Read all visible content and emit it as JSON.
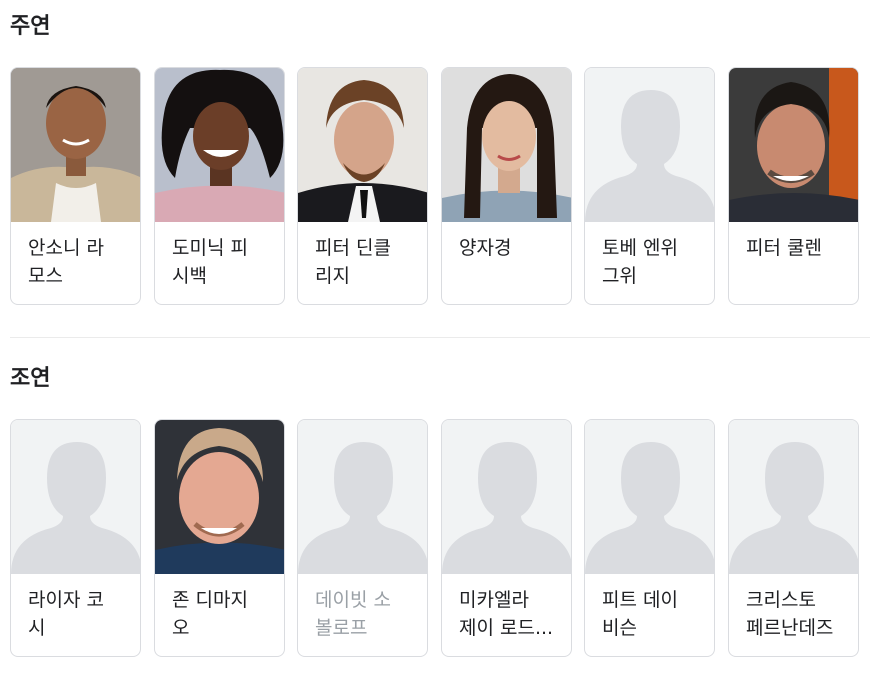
{
  "sections": [
    {
      "title": "주연",
      "cast": [
        {
          "name": "안소니 라\n모스",
          "photo": "person-photo"
        },
        {
          "name": "도미닉 피\n시백",
          "photo": "person-photo"
        },
        {
          "name": "피터 딘클\n리지",
          "photo": "person-photo"
        },
        {
          "name": "양자경",
          "photo": "person-photo"
        },
        {
          "name": "토베 엔위\n그위",
          "photo": "placeholder-silhouette"
        },
        {
          "name": "피터 쿨렌",
          "photo": "person-photo"
        }
      ]
    },
    {
      "title": "조연",
      "cast": [
        {
          "name": "라이자 코\n시",
          "photo": "placeholder-silhouette"
        },
        {
          "name": "존 디마지\n오",
          "photo": "person-photo"
        },
        {
          "name": "데이빗 소\n볼로프",
          "photo": "placeholder-silhouette"
        },
        {
          "name": "미카엘라\n제이 로드...",
          "photo": "placeholder-silhouette"
        },
        {
          "name": "피트 데이\n비슨",
          "photo": "placeholder-silhouette"
        },
        {
          "name": "크리스토\n페르난데즈",
          "photo": "placeholder-silhouette"
        }
      ]
    }
  ],
  "colors": {
    "placeholder_bg": "#f1f3f4",
    "silhouette": "#dadce0",
    "card_border": "#dadce0"
  }
}
